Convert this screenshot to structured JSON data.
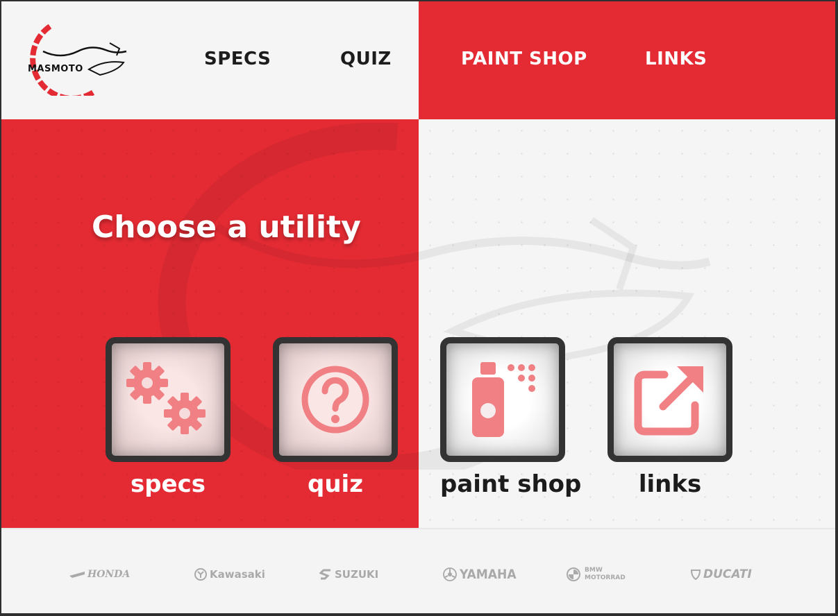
{
  "logo": {
    "text": "MASMOTO"
  },
  "nav": {
    "specs": "SPECS",
    "quiz": "QUIZ",
    "paint_shop": "PAINT SHOP",
    "links": "LINKS"
  },
  "hero": {
    "title": "Choose a utility",
    "tiles": [
      {
        "label": "specs",
        "icon": "gears-icon"
      },
      {
        "label": "quiz",
        "icon": "question-circle-icon"
      },
      {
        "label": "paint shop",
        "icon": "spray-paint-icon"
      },
      {
        "label": "links",
        "icon": "external-link-icon"
      }
    ]
  },
  "footer": {
    "brands": [
      "HONDA",
      "Kawasaki",
      "SUZUKI",
      "YAMAHA",
      "BMW",
      "MOTORRAD",
      "DUCATI"
    ]
  },
  "colors": {
    "brand_red": "#e42b33",
    "light_bg": "#f5f5f5",
    "dark": "#333333",
    "icon_pink": "#f08083",
    "brand_gray": "#a9a9a9"
  }
}
